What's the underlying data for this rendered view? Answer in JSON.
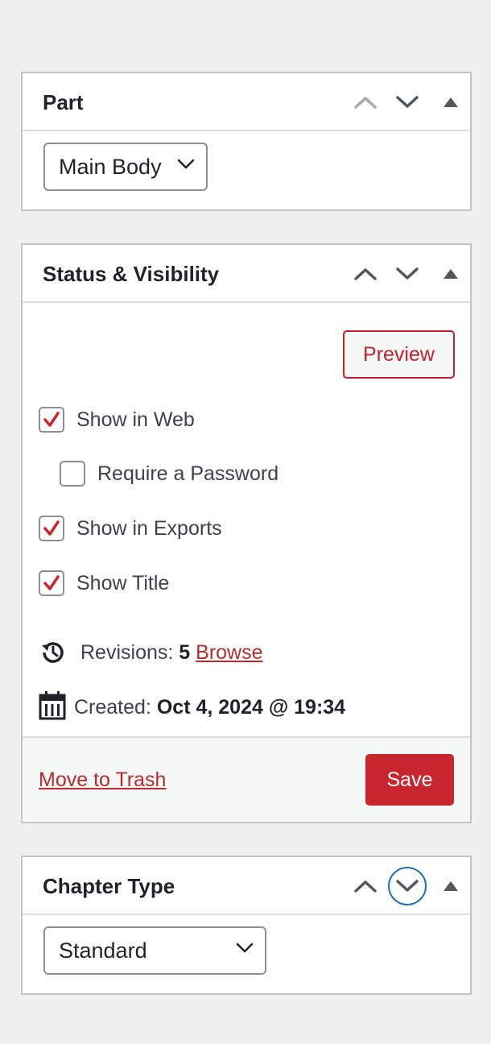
{
  "part_panel": {
    "title": "Part",
    "move_up_icon": "chevron-up-icon",
    "move_down_icon": "chevron-down-icon",
    "toggle_icon": "triangle-up-icon",
    "select_value": "Main Body"
  },
  "status_panel": {
    "title": "Status & Visibility",
    "preview_label": "Preview",
    "checkboxes": [
      {
        "label": "Show in Web",
        "checked": true
      },
      {
        "label": "Require a Password",
        "checked": false
      },
      {
        "label": "Show in Exports",
        "checked": true
      },
      {
        "label": "Show Title",
        "checked": true
      }
    ],
    "revisions_label": "Revisions:",
    "revisions_count": "5",
    "browse_label": "Browse",
    "created_label": "Created:",
    "created_value": "Oct 4, 2024 @ 19:34",
    "trash_label": "Move to Trash",
    "save_label": "Save"
  },
  "chapter_panel": {
    "title": "Chapter Type",
    "select_value": "Standard"
  },
  "colors": {
    "accent_red": "#c9252f",
    "focus_blue": "#2271b1",
    "background": "#f0f0f1"
  }
}
